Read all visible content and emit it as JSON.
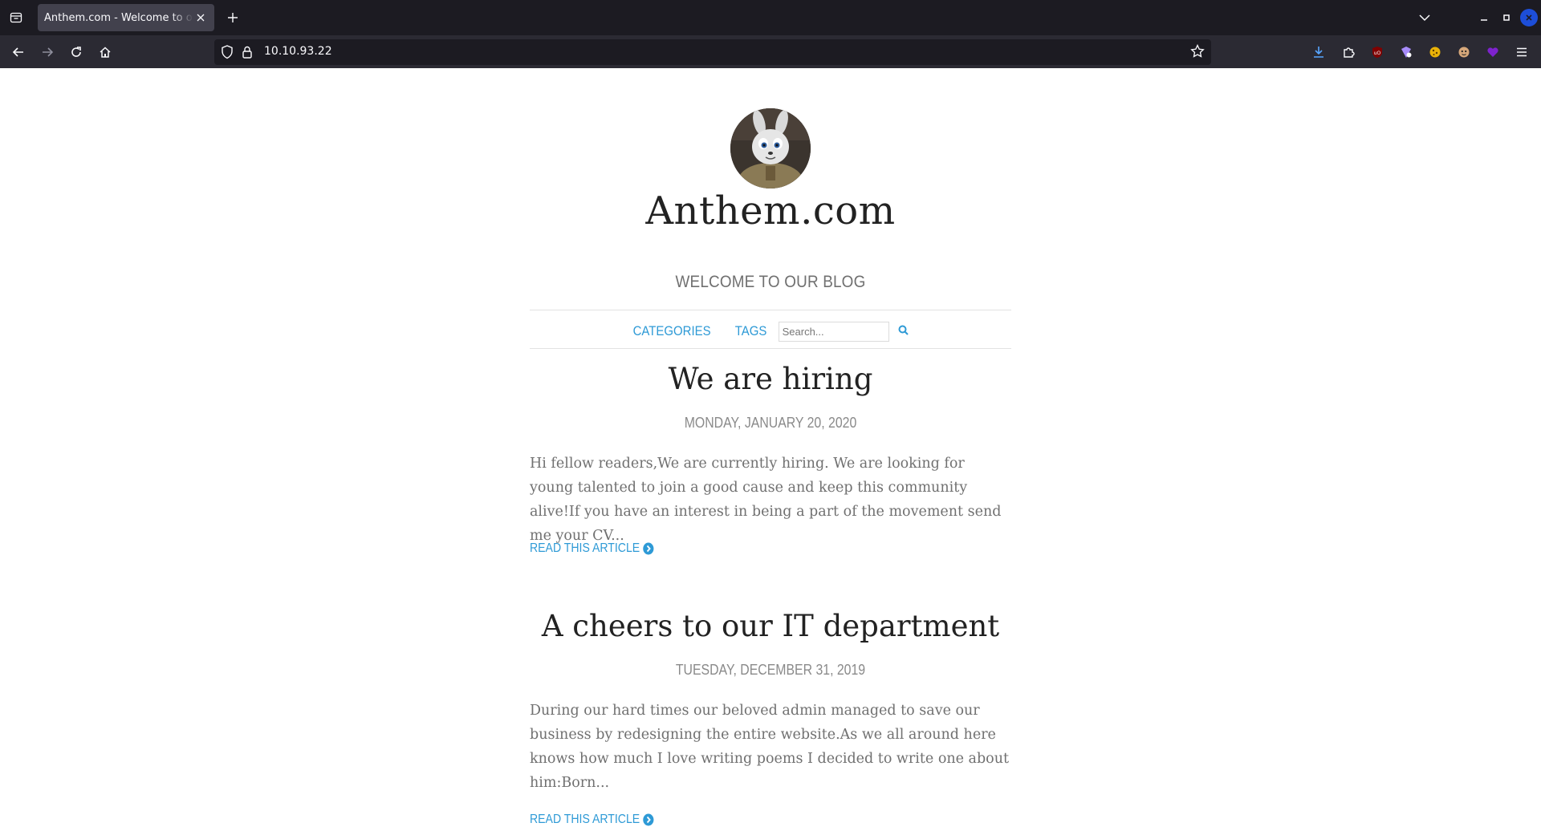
{
  "browser": {
    "tab": {
      "title": "Anthem.com - Welcome to our blog"
    },
    "url": "10.10.93.22",
    "extension_badge": "13"
  },
  "site": {
    "title": "Anthem.com",
    "tagline": "WELCOME TO OUR BLOG",
    "nav": {
      "categories": "CATEGORIES",
      "tags": "TAGS",
      "search_placeholder": "Search..."
    }
  },
  "posts": [
    {
      "title": "We are hiring",
      "date": "MONDAY, JANUARY 20, 2020",
      "excerpt": "Hi fellow readers,We are currently hiring. We are looking for young talented to join a good cause and keep this community alive!If you have an interest in being a part of the movement send me your CV...",
      "read_more": "READ THIS ARTICLE"
    },
    {
      "title": "A cheers to our IT department",
      "date": "TUESDAY, DECEMBER 31, 2019",
      "excerpt": "During our hard times our beloved admin managed to save our business by redesigning the entire website.As we all around here knows how much I love writing poems I decided to write one about him:Born...",
      "read_more": "READ THIS ARTICLE"
    }
  ],
  "colors": {
    "link": "#2e9ad6",
    "chrome_dark": "#1c1b22",
    "chrome_toolbar": "#2b2a33"
  }
}
